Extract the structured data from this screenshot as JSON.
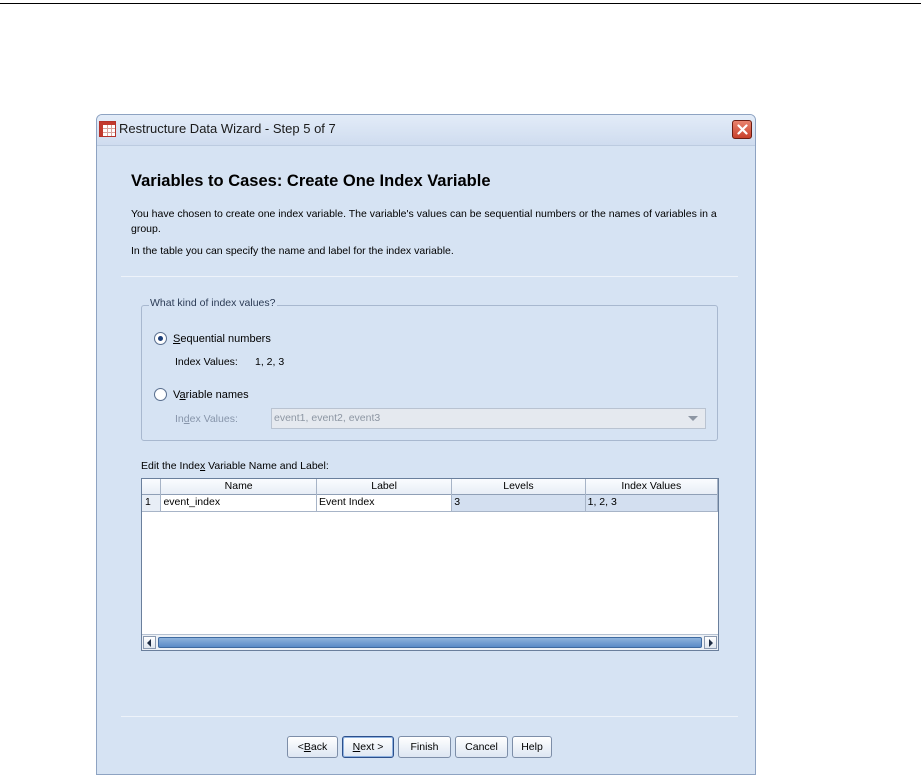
{
  "window": {
    "title": "Restructure Data Wizard - Step 5 of 7"
  },
  "page": {
    "heading": "Variables to Cases: Create One Index Variable",
    "description_1": "You have chosen to create one index variable. The variable's values can be sequential numbers or the names of variables in a group.",
    "description_2": "In the table you can specify the name and label for the index variable."
  },
  "index_values_group": {
    "legend": "What kind of index values?",
    "options": [
      {
        "label": "Sequential numbers",
        "selected": true
      },
      {
        "label": "Variable names",
        "selected": false
      }
    ],
    "sequential_index_label": "Index Values:",
    "sequential_index_value": "1, 2, 3",
    "names_index_label": "Index Values:",
    "names_index_value": "event1, event2, event3"
  },
  "grid": {
    "caption": "Edit the Index Variable Name and Label:",
    "columns": [
      "",
      "Name",
      "Label",
      "Levels",
      "Index Values"
    ],
    "rows": [
      {
        "num": "1",
        "name": "event_index",
        "label": "Event Index",
        "levels": "3",
        "index_values": "1, 2, 3"
      }
    ]
  },
  "buttons": {
    "back": "< Back",
    "next": "Next >",
    "finish": "Finish",
    "cancel": "Cancel",
    "help": "Help"
  },
  "icons": {
    "app": "spreadsheet-icon",
    "close": "close-icon"
  },
  "colors": {
    "dialog_bg": "#d6e3f3",
    "close_button": "#c8412c",
    "scroll_thumb": "#5a8bc7"
  }
}
